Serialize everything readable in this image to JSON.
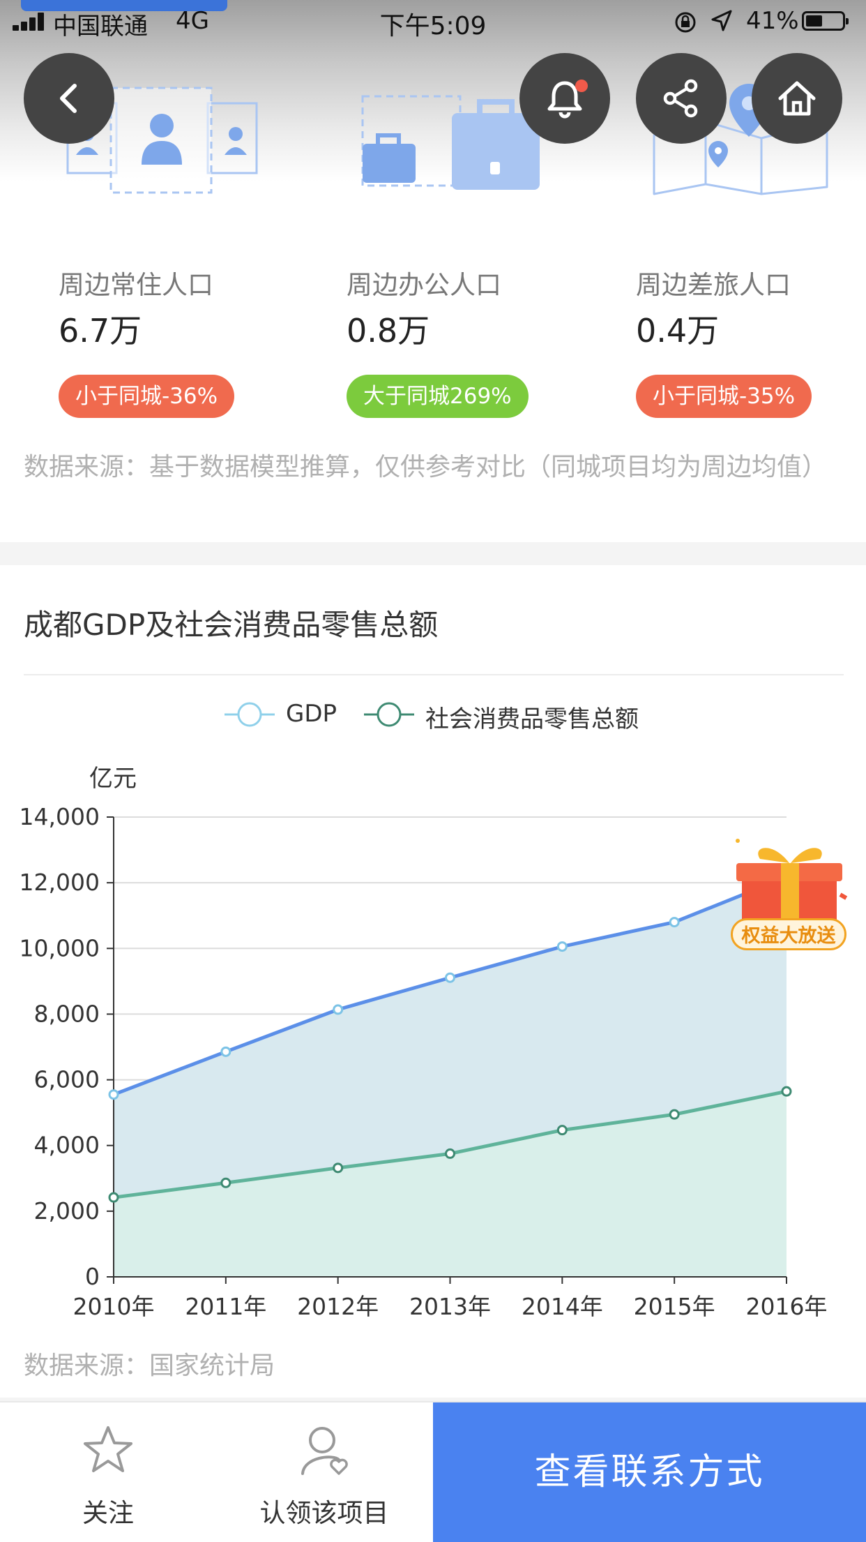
{
  "status_bar": {
    "carrier": "中国联通",
    "network": "4G",
    "time": "下午5:09",
    "battery": "41%",
    "battery_level": 0.41
  },
  "population": {
    "items": [
      {
        "label": "周边常住人口",
        "value": "6.7万",
        "badge": "小于同城-36%",
        "badge_color": "#f06a4e"
      },
      {
        "label": "周边办公人口",
        "value": "0.8万",
        "badge": "大于同城269%",
        "badge_color": "#7ccb3d"
      },
      {
        "label": "周边差旅人口",
        "value": "0.4万",
        "badge": "小于同城-35%",
        "badge_color": "#f06a4e"
      }
    ],
    "source": "数据来源：基于数据模型推算，仅供参考对比（同城项目均为周边均值）"
  },
  "chart_section": {
    "title": "成都GDP及社会消费品零售总额",
    "unit": "亿元",
    "source": "数据来源：国家统计局"
  },
  "chart_data": {
    "type": "area",
    "categories": [
      "2010年",
      "2011年",
      "2012年",
      "2013年",
      "2014年",
      "2015年",
      "2016年"
    ],
    "series": [
      {
        "name": "GDP",
        "values": [
          5551,
          6855,
          8139,
          9109,
          10057,
          10801,
          12170
        ],
        "color": "#5b8fe8"
      },
      {
        "name": "社会消费品零售总额",
        "values": [
          2418,
          2862,
          3318,
          3752,
          4468,
          4946,
          5648
        ],
        "color": "#5fb39a"
      }
    ],
    "ylabel": "亿元",
    "ylim": [
      0,
      14000
    ],
    "yticks": [
      "0",
      "2,000",
      "4,000",
      "6,000",
      "8,000",
      "10,000",
      "12,000",
      "14,000"
    ],
    "grid": true,
    "legend_position": "top"
  },
  "promo": {
    "label": "权益大放送"
  },
  "bottom_bar": {
    "follow_label": "关注",
    "claim_label": "认领该项目",
    "contact_label": "查看联系方式"
  },
  "colors": {
    "accent": "#4a82f0",
    "badge_red": "#f06a4e",
    "badge_green": "#7ccb3d"
  }
}
